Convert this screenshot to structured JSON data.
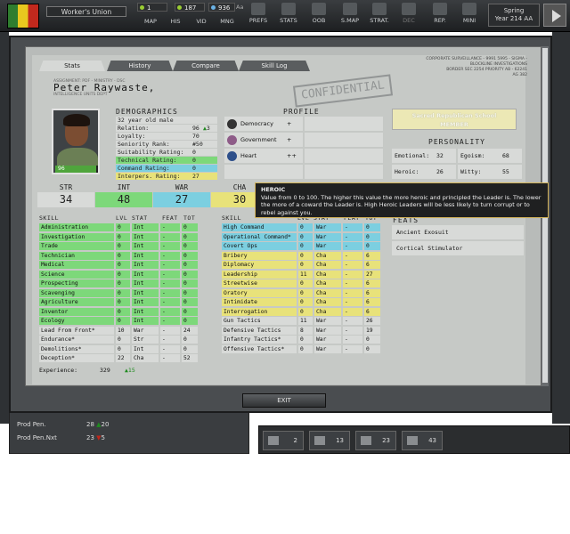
{
  "topbar": {
    "faction_name": "Worker's Union",
    "resources": [
      "1",
      "187",
      "936"
    ],
    "resource_trail": "Aa",
    "buttons": [
      "MAP",
      "HIS",
      "VID",
      "MNG",
      "PREFS",
      "STATS",
      "OOB",
      "S.MAP",
      "STRAT.",
      "DEC",
      "REP.",
      "MINI"
    ],
    "season": "Spring",
    "year": "Year 214 AA"
  },
  "tabs": [
    "Stats",
    "History",
    "Compare",
    "Skill Log"
  ],
  "header_small": [
    "CORPORATE SURVEILLANCE - 9991 5995 - SIGMA - BLOCKLINE INVESTIGATIONS",
    "BORDER SEC 2254 PRIORITY AB - 62241",
    "AG 382"
  ],
  "agent": {
    "name": "Peter Raywaste,",
    "sub_top": "ASSIGNMENT: PDF - MINISTRY - DSC",
    "sub_bottom": "INTELLIGENCE UNITS DEPT",
    "stamp": "CONFIDENTIAL",
    "portrait_hp": "96",
    "portrait_hp_fraction": 0.96
  },
  "demographics": {
    "title": "DEMOGRAPHICS",
    "rows": [
      {
        "label": "32 year old male",
        "value": "",
        "color": "gray"
      },
      {
        "label": "Relation:",
        "value": "96",
        "delta": "3",
        "color": "gray"
      },
      {
        "label": "Loyalty:",
        "value": "70",
        "color": "gray"
      },
      {
        "label": "Seniority Rank:",
        "value": "#50",
        "color": "gray"
      },
      {
        "label": "Suitability Rating:",
        "value": "0",
        "color": "gray"
      },
      {
        "label": "Technical Rating:",
        "value": "0",
        "color": "green"
      },
      {
        "label": "Command Rating:",
        "value": "0",
        "color": "cyan"
      },
      {
        "label": "Interpers. Rating:",
        "value": "27",
        "color": "yellow"
      }
    ]
  },
  "profile": {
    "title": "PROFILE",
    "rows": [
      {
        "icon": "star-icon",
        "label": "Democracy",
        "value": "+"
      },
      {
        "icon": "government-icon",
        "label": "Government",
        "value": "+"
      },
      {
        "icon": "heart-icon",
        "label": "Heart",
        "value": "++"
      }
    ]
  },
  "school": {
    "line1": "Sacred Republican School",
    "line2": "MEMBER"
  },
  "personality": {
    "title": "PERSONALITY",
    "rows": [
      [
        {
          "label": "Emotional:",
          "value": "32"
        },
        {
          "label": "Egoism:",
          "value": "68"
        }
      ],
      [
        {
          "label": "Heroic:",
          "value": "26"
        },
        {
          "label": "Witty:",
          "value": "55"
        }
      ]
    ]
  },
  "stats": {
    "labels": [
      "STR",
      "INT",
      "WAR",
      "CHA"
    ],
    "values": [
      "34",
      "48",
      "27",
      "30"
    ]
  },
  "skills": {
    "headers": [
      "SKILL",
      "LVL",
      "STAT",
      "FEAT",
      "TOT"
    ],
    "left": [
      [
        "Administration",
        "0",
        "Int",
        "-",
        "0",
        "green"
      ],
      [
        "Investigation",
        "0",
        "Int",
        "-",
        "0",
        "green"
      ],
      [
        "Trade",
        "0",
        "Int",
        "-",
        "0",
        "green"
      ],
      [
        "Technician",
        "0",
        "Int",
        "-",
        "0",
        "green"
      ],
      [
        "Medical",
        "0",
        "Int",
        "-",
        "0",
        "green"
      ],
      [
        "Science",
        "0",
        "Int",
        "-",
        "0",
        "green"
      ],
      [
        "Prospecting",
        "0",
        "Int",
        "-",
        "0",
        "green"
      ],
      [
        "Scavenging",
        "0",
        "Int",
        "-",
        "0",
        "green"
      ],
      [
        "Agriculture",
        "0",
        "Int",
        "-",
        "0",
        "green"
      ],
      [
        "Inventor",
        "0",
        "Int",
        "-",
        "0",
        "green"
      ],
      [
        "Ecology",
        "0",
        "Int",
        "-",
        "0",
        "green"
      ],
      [
        "Lead From Front*",
        "10",
        "War",
        "-",
        "24",
        "gray"
      ],
      [
        "Endurance*",
        "0",
        "Str",
        "-",
        "0",
        "gray"
      ],
      [
        "Demolitions*",
        "0",
        "Int",
        "-",
        "0",
        "gray"
      ],
      [
        "Deception*",
        "22",
        "Cha",
        "-",
        "52",
        "gray"
      ]
    ],
    "right": [
      [
        "High Command",
        "0",
        "War",
        "-",
        "0",
        "cyan"
      ],
      [
        "Operational Command*",
        "0",
        "War",
        "-",
        "0",
        "cyan"
      ],
      [
        "Covert Ops",
        "0",
        "War",
        "-",
        "0",
        "cyan"
      ],
      [
        "Bribery",
        "0",
        "Cha",
        "-",
        "6",
        "yellow"
      ],
      [
        "Diplomacy",
        "0",
        "Cha",
        "-",
        "6",
        "yellow"
      ],
      [
        "Leadership",
        "11",
        "Cha",
        "-",
        "27",
        "yellow"
      ],
      [
        "Streetwise",
        "0",
        "Cha",
        "-",
        "6",
        "yellow"
      ],
      [
        "Oratory",
        "0",
        "Cha",
        "-",
        "6",
        "yellow"
      ],
      [
        "Intimidate",
        "0",
        "Cha",
        "-",
        "6",
        "yellow"
      ],
      [
        "Interrogation",
        "0",
        "Cha",
        "-",
        "6",
        "yellow"
      ],
      [
        "Gun Tactics",
        "11",
        "War",
        "-",
        "26",
        "gray"
      ],
      [
        "Defensive Tactics",
        "8",
        "War",
        "-",
        "19",
        "gray"
      ],
      [
        "Infantry Tactics*",
        "0",
        "War",
        "-",
        "0",
        "gray"
      ],
      [
        "Offensive Tactics*",
        "0",
        "War",
        "-",
        "0",
        "gray"
      ]
    ]
  },
  "experience": {
    "label": "Experience:",
    "value": "329",
    "delta": "15"
  },
  "feats": {
    "title": "FEATS",
    "items": [
      "Ancient Exosuit",
      "Cortical Stimulator"
    ]
  },
  "tooltip": {
    "title": "HEROIC",
    "body": "Value from 0 to 100. The higher this value the more heroic and principled the Leader is. The lower the more of a coward the Leader is. High Heroic Leaders will be less likely to turn corrupt or to rebel against you."
  },
  "exit_label": "EXIT",
  "bottom_panel": [
    {
      "label": "Prod Pen.",
      "value": "28",
      "delta": "20",
      "dir": "up"
    },
    {
      "label": "Prod Pen.Nxt",
      "value": "23",
      "delta": "5",
      "dir": "down"
    }
  ],
  "bottom_bar": [
    "2",
    "13",
    "23",
    "43"
  ]
}
